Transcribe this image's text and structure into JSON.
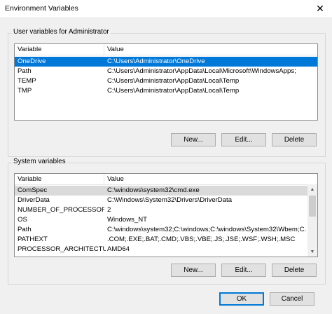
{
  "window": {
    "title": "Environment Variables",
    "close_glyph": "✕"
  },
  "user_vars": {
    "label": "User variables for Administrator",
    "columns": [
      "Variable",
      "Value"
    ],
    "rows": [
      {
        "variable": "OneDrive",
        "value": "C:\\Users\\Administrator\\OneDrive",
        "selected": true
      },
      {
        "variable": "Path",
        "value": "C:\\Users\\Administrator\\AppData\\Local\\Microsoft\\WindowsApps;"
      },
      {
        "variable": "TEMP",
        "value": "C:\\Users\\Administrator\\AppData\\Local\\Temp"
      },
      {
        "variable": "TMP",
        "value": "C:\\Users\\Administrator\\AppData\\Local\\Temp"
      }
    ],
    "buttons": {
      "new": "New...",
      "edit": "Edit...",
      "delete": "Delete"
    }
  },
  "system_vars": {
    "label": "System variables",
    "columns": [
      "Variable",
      "Value"
    ],
    "rows": [
      {
        "variable": "ComSpec",
        "value": "C:\\windows\\system32\\cmd.exe",
        "highlighted": true
      },
      {
        "variable": "DriverData",
        "value": "C:\\Windows\\System32\\Drivers\\DriverData"
      },
      {
        "variable": "NUMBER_OF_PROCESSORS",
        "value": "2"
      },
      {
        "variable": "OS",
        "value": "Windows_NT"
      },
      {
        "variable": "Path",
        "value": "C:\\windows\\system32;C:\\windows;C:\\windows\\System32\\Wbem;C..."
      },
      {
        "variable": "PATHEXT",
        "value": ".COM;.EXE;.BAT;.CMD;.VBS;.VBE;.JS;.JSE;.WSF;.WSH;.MSC"
      },
      {
        "variable": "PROCESSOR_ARCHITECTURE",
        "value": "AMD64"
      }
    ],
    "buttons": {
      "new": "New...",
      "edit": "Edit...",
      "delete": "Delete"
    }
  },
  "dialog_buttons": {
    "ok": "OK",
    "cancel": "Cancel"
  },
  "icons": {
    "scroll_up": "arrow-up-icon",
    "scroll_down": "arrow-down-icon",
    "close": "close-icon"
  },
  "colors": {
    "selection": "#0078d7",
    "row_highlight": "#dadada"
  }
}
